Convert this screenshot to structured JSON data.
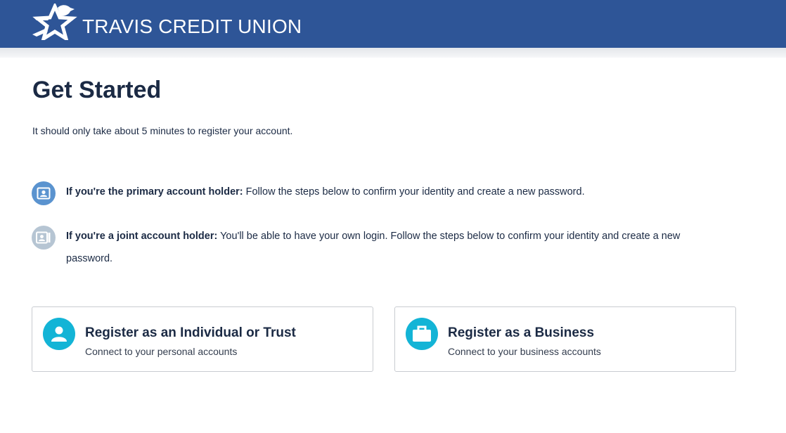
{
  "header": {
    "brand": "TRAVIS CREDIT UNION",
    "logo_icon": "star-logo-icon",
    "background_color": "#2e5597"
  },
  "main": {
    "title": "Get Started",
    "subtitle": "It should only take about 5 minutes to register your account."
  },
  "holders": [
    {
      "icon": "id-card-icon",
      "icon_color": "#5a93cf",
      "label": "If you're the primary account holder:",
      "text": " Follow the steps below to confirm your identity and create a new password."
    },
    {
      "icon": "joint-id-card-icon",
      "icon_color": "#b6c5d3",
      "label": "If you're a joint account holder:",
      "text": " You'll be able to have your own login. Follow the steps below to confirm your identity and create a new password."
    }
  ],
  "cards": [
    {
      "icon": "user-icon",
      "title": "Register as an Individual or Trust",
      "subtitle": "Connect to your personal accounts"
    },
    {
      "icon": "briefcase-icon",
      "title": "Register as a Business",
      "subtitle": "Connect to your business accounts"
    }
  ],
  "colors": {
    "accent": "#13b4d6",
    "text": "#1b2a44"
  }
}
